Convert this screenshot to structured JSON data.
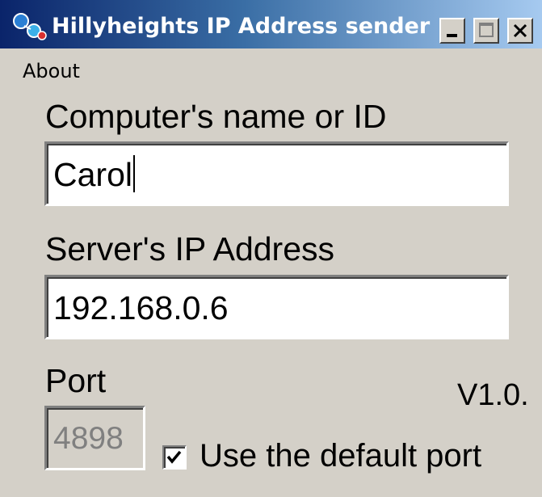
{
  "window": {
    "title": "Hillyheights IP Address sender",
    "icon": "app-network-icon",
    "caption_buttons": [
      "minimize-icon",
      "maximize-icon",
      "close-icon"
    ]
  },
  "menu": {
    "items": [
      {
        "label": "About"
      }
    ]
  },
  "form": {
    "computer_name": {
      "label": "Computer's name or ID",
      "value": "Carol"
    },
    "server_ip": {
      "label": "Server's IP Address",
      "value": "192.168.0.6"
    },
    "port": {
      "label": "Port",
      "value": "4898",
      "disabled": true
    },
    "default_port": {
      "label": "Use the default port",
      "checked": true
    }
  },
  "version": "V1.0.",
  "colors": {
    "face": "#d4d0c8",
    "titlebar_start": "#0a246a",
    "titlebar_end": "#a6caf0",
    "disabled_text": "#808080"
  }
}
